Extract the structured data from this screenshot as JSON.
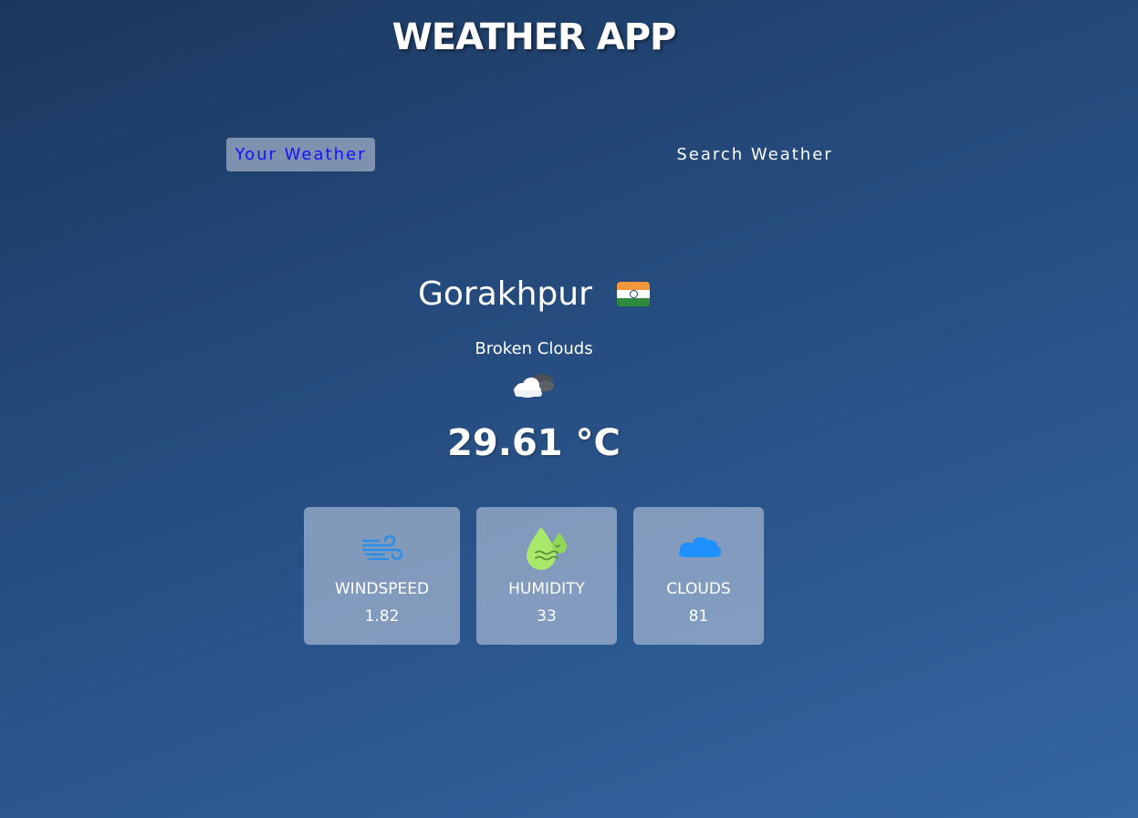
{
  "header": {
    "title": "WEATHER APP"
  },
  "tabs": [
    {
      "label": "Your Weather",
      "active": true
    },
    {
      "label": "Search Weather",
      "active": false
    }
  ],
  "location": {
    "city": "Gorakhpur",
    "flag_icon": "india-flag-icon"
  },
  "current": {
    "description": "Broken Clouds",
    "icon": "cloud-sun-icon",
    "temperature": "29.61 °C"
  },
  "stats": [
    {
      "label": "WINDSPEED",
      "value": "1.82",
      "icon": "wind-icon"
    },
    {
      "label": "HUMIDITY",
      "value": "33",
      "icon": "humidity-drop-icon"
    },
    {
      "label": "CLOUDS",
      "value": "81",
      "icon": "clouds-icon"
    }
  ],
  "colors": {
    "active_tab_text": "#1212ff",
    "wind_icon": "#2a8ee6",
    "humidity_icon": "#a8e86a",
    "clouds_icon": "#1e90ff"
  }
}
